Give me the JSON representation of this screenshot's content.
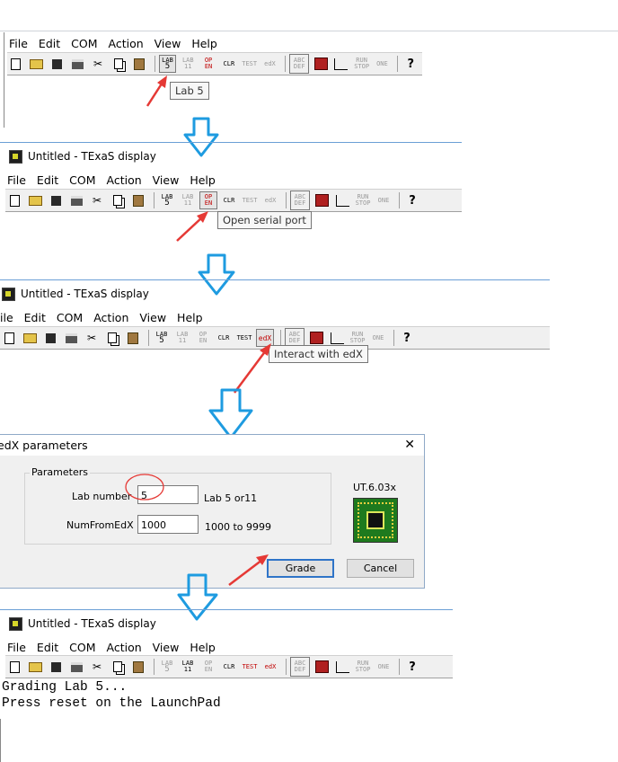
{
  "menu": {
    "file": "File",
    "file_cut": "ile",
    "edit": "Edit",
    "com": "COM",
    "action": "Action",
    "view": "View",
    "help": "Help"
  },
  "toolbar": {
    "lab5_top": "LAB",
    "lab5_num": "5",
    "lab11_top": "LAB",
    "lab11_num": "11",
    "open_top": "OP",
    "open_bottom": "EN",
    "clr": "CLR",
    "test": "TEST",
    "edx": "edX",
    "abc_top": "ABC",
    "abc_bottom": "DEF",
    "run_top": "RUN",
    "run_bottom": "STOP",
    "one": "ONE"
  },
  "window": {
    "title": "Untitled - TExaS display"
  },
  "tooltips": {
    "lab5": "Lab 5",
    "open_serial": "Open serial port",
    "interact_edx": "Interact with edX"
  },
  "dialog": {
    "title": "edX parameters",
    "close": "✕",
    "group_label": "Parameters",
    "lab_number_label": "Lab number",
    "lab_number_value": "5",
    "lab_number_hint": "Lab 5 or11",
    "num_from_edx_label": "NumFromEdX",
    "num_from_edx_value": "1000",
    "num_from_edx_hint": "1000 to 9999",
    "version": "UT.6.03x",
    "grade_button": "Grade",
    "cancel_button": "Cancel"
  },
  "console": {
    "line1": "Grading Lab 5...",
    "line2": "Press reset on the LaunchPad"
  },
  "colors": {
    "blue_arrow": "#1e9be0",
    "red_arrow": "#e53935",
    "highlight_circle": "#e53935"
  }
}
